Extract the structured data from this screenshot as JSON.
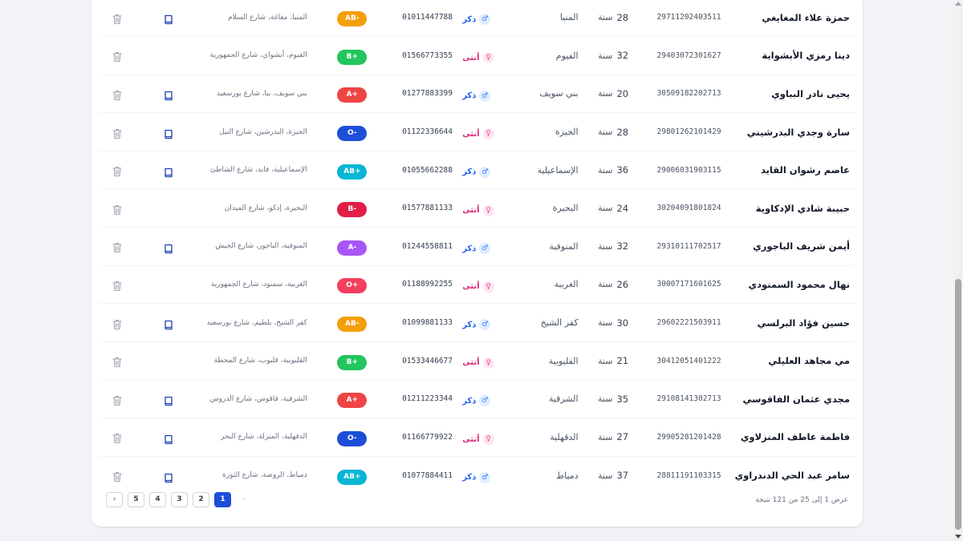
{
  "colors": {
    "blood": {
      "AB-": "#f59e0b",
      "B+": "#22c55e",
      "A+": "#ef4444",
      "O-": "#1d4ed8",
      "AB+": "#06b6d4",
      "B-": "#e11d48",
      "A-": "#a855f7",
      "O+": "#f43f5e"
    },
    "accent": "#1d4ed8"
  },
  "patients": [
    {
      "name": "حمزة علاء المغايغي",
      "national_id": "29711202403511",
      "age": "28",
      "age_unit": "سنة",
      "governorate": "المنيا",
      "gender": "ذكر",
      "gender_key": "male",
      "phone": "01011447788",
      "blood_type": "AB-",
      "address": "المنيا، مغاغة، شارع السلام",
      "has_record": true
    },
    {
      "name": "دينا رمزي الأبشواية",
      "national_id": "29403072301627",
      "age": "32",
      "age_unit": "سنة",
      "governorate": "الفيوم",
      "gender": "أنثى",
      "gender_key": "female",
      "phone": "01566773355",
      "blood_type": "B+",
      "address": "الفيوم، أبشواي، شارع الجمهورية",
      "has_record": false
    },
    {
      "name": "يحيى نادر البباوي",
      "national_id": "30509182202713",
      "age": "20",
      "age_unit": "سنة",
      "governorate": "بني سويف",
      "gender": "ذكر",
      "gender_key": "male",
      "phone": "01277883399",
      "blood_type": "A+",
      "address": "بني سويف، ببا، شارع بورسعيد",
      "has_record": true
    },
    {
      "name": "سارة وجدي البدرشيني",
      "national_id": "29801262101429",
      "age": "28",
      "age_unit": "سنة",
      "governorate": "الجيزة",
      "gender": "أنثى",
      "gender_key": "female",
      "phone": "01122336644",
      "blood_type": "O-",
      "address": "الجيزة، البدرشين، شارع النيل",
      "has_record": true
    },
    {
      "name": "عاصم رشوان القايد",
      "national_id": "29006031903115",
      "age": "36",
      "age_unit": "سنة",
      "governorate": "الإسماعيلية",
      "gender": "ذكر",
      "gender_key": "male",
      "phone": "01055662288",
      "blood_type": "AB+",
      "address": "الإسماعيلية، فايد، شارع الشاطئ",
      "has_record": true
    },
    {
      "name": "حبيبة شادي الإدكاوية",
      "national_id": "30204091801824",
      "age": "24",
      "age_unit": "سنة",
      "governorate": "البحيرة",
      "gender": "أنثى",
      "gender_key": "female",
      "phone": "01577881133",
      "blood_type": "B-",
      "address": "البحيرة، إدكو، شارع الميدان",
      "has_record": false
    },
    {
      "name": "أيمن شريف الباجوري",
      "national_id": "29310111702517",
      "age": "32",
      "age_unit": "سنة",
      "governorate": "المنوفية",
      "gender": "ذكر",
      "gender_key": "male",
      "phone": "01244558811",
      "blood_type": "A-",
      "address": "المنوفية، الباجور، شارع الجيش",
      "has_record": true
    },
    {
      "name": "نهال محمود السمنودي",
      "national_id": "30007171601625",
      "age": "26",
      "age_unit": "سنة",
      "governorate": "الغربية",
      "gender": "أنثى",
      "gender_key": "female",
      "phone": "01188992255",
      "blood_type": "O+",
      "address": "الغربية، سمنود، شارع الجمهورية",
      "has_record": false
    },
    {
      "name": "حسين فؤاد البرلسي",
      "national_id": "29602221503911",
      "age": "30",
      "age_unit": "سنة",
      "governorate": "كفر الشيخ",
      "gender": "ذكر",
      "gender_key": "male",
      "phone": "01099881133",
      "blood_type": "AB-",
      "address": "كفر الشيخ، بلطيم، شارع بورسعيد",
      "has_record": true
    },
    {
      "name": "مي مجاهد العليلي",
      "national_id": "30412051401222",
      "age": "21",
      "age_unit": "سنة",
      "governorate": "القليوبية",
      "gender": "أنثى",
      "gender_key": "female",
      "phone": "01533446677",
      "blood_type": "B+",
      "address": "القليوبية، قليوب، شارع المحطة",
      "has_record": false
    },
    {
      "name": "مجدي عثمان الفاقوسي",
      "national_id": "29108141302713",
      "age": "35",
      "age_unit": "سنة",
      "governorate": "الشرقية",
      "gender": "ذكر",
      "gender_key": "male",
      "phone": "01211223344",
      "blood_type": "A+",
      "address": "الشرقية، فاقوس، شارع الدروس",
      "has_record": true
    },
    {
      "name": "فاطمة عاطف المنزلاوي",
      "national_id": "29905281201428",
      "age": "27",
      "age_unit": "سنة",
      "governorate": "الدقهلية",
      "gender": "أنثى",
      "gender_key": "female",
      "phone": "01166779922",
      "blood_type": "O-",
      "address": "الدقهلية، المنزلة، شارع البحر",
      "has_record": true
    },
    {
      "name": "سامر عبد الحي الدندراوي",
      "national_id": "28811191103315",
      "age": "37",
      "age_unit": "سنة",
      "governorate": "دمياط",
      "gender": "ذكر",
      "gender_key": "male",
      "phone": "01077884411",
      "blood_type": "AB+",
      "address": "دمياط، الروضة، شارع الثورة",
      "has_record": true
    }
  ],
  "pagination": {
    "pages": [
      "5",
      "4",
      "3",
      "2",
      "1"
    ],
    "active_page": "1",
    "next_icon": "‹",
    "prev_icon": "›",
    "results_text": "عرض 1 إلى 25 من 121 نتيجة"
  }
}
